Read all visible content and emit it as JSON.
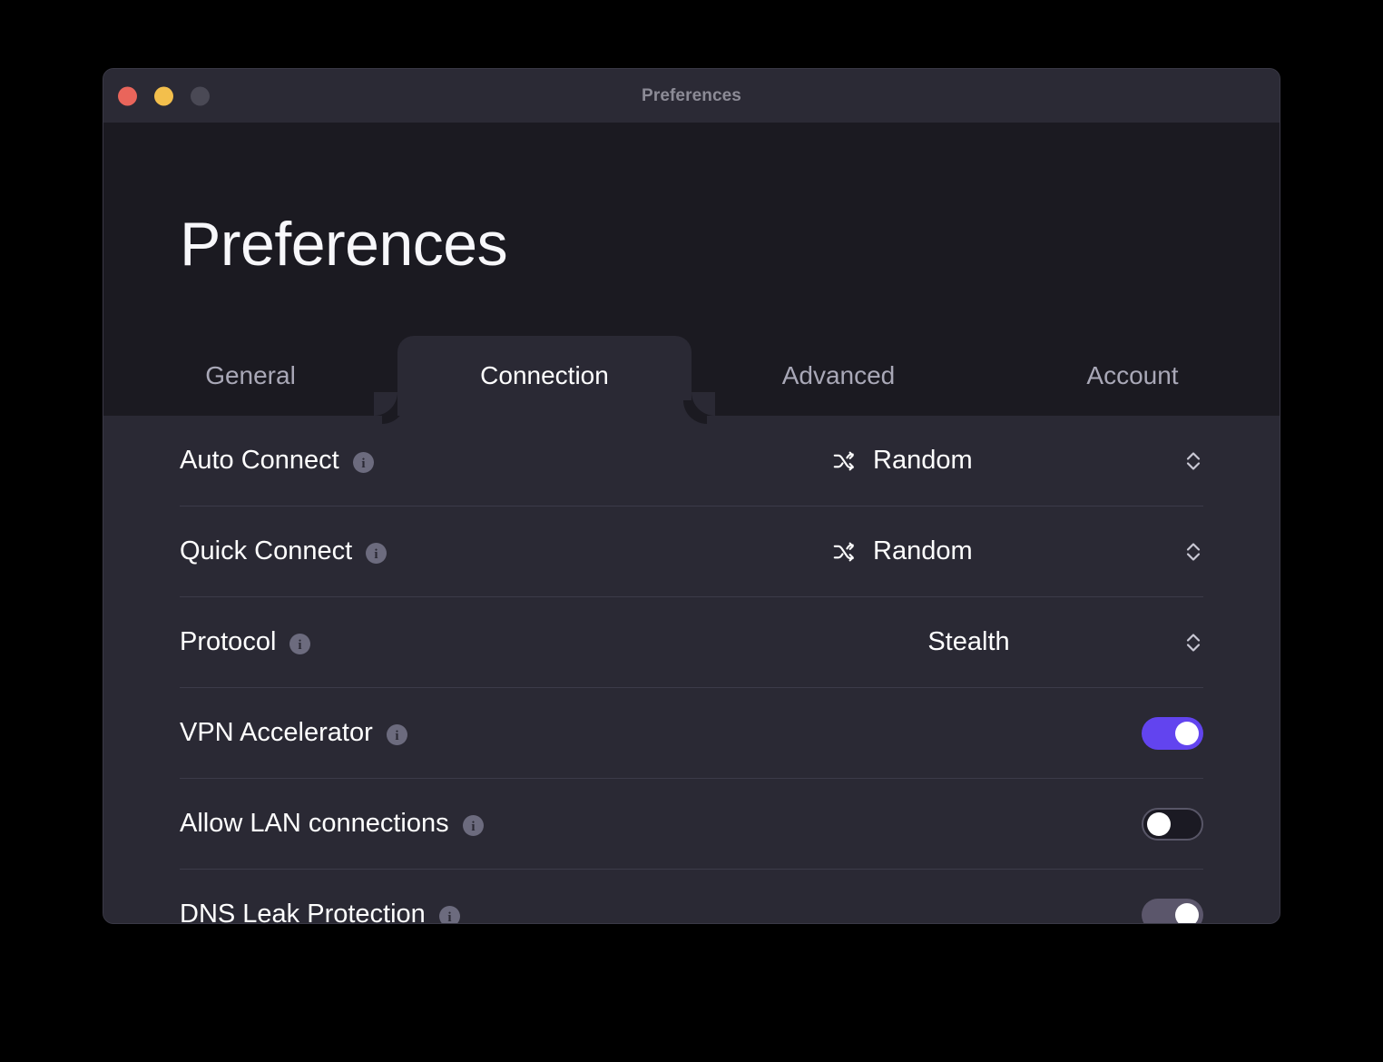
{
  "window": {
    "titlebar_title": "Preferences",
    "traffic_lights": [
      {
        "name": "close",
        "color": "#e9655b"
      },
      {
        "name": "minimize",
        "color": "#f3bf4c"
      },
      {
        "name": "zoom",
        "color": "#4a4955"
      }
    ]
  },
  "header": {
    "page_title": "Preferences"
  },
  "tabs": [
    {
      "label": "General",
      "active": false
    },
    {
      "label": "Connection",
      "active": true
    },
    {
      "label": "Advanced",
      "active": false
    },
    {
      "label": "Account",
      "active": false
    }
  ],
  "settings": [
    {
      "label": "Auto Connect",
      "info_icon": "info-icon",
      "control": "select",
      "value": "Random",
      "value_icon": "shuffle-icon",
      "stepper_icon": "chevron-up-down-icon"
    },
    {
      "label": "Quick Connect",
      "info_icon": "info-icon",
      "control": "select",
      "value": "Random",
      "value_icon": "shuffle-icon",
      "stepper_icon": "chevron-up-down-icon"
    },
    {
      "label": "Protocol",
      "info_icon": "info-icon",
      "control": "select",
      "value": "Stealth",
      "value_icon": null,
      "stepper_icon": "chevron-up-down-icon"
    },
    {
      "label": "VPN Accelerator",
      "info_icon": "info-icon",
      "control": "toggle",
      "state": "on",
      "toggle_color": "#6244ef"
    },
    {
      "label": "Allow LAN connections",
      "info_icon": "info-icon",
      "control": "toggle",
      "state": "off",
      "toggle_color": "#1b1a23"
    },
    {
      "label": "DNS Leak Protection",
      "info_icon": "info-icon",
      "control": "toggle",
      "state": "on-muted",
      "toggle_color": "#5b566b"
    }
  ],
  "colors": {
    "accent": "#6244ef",
    "header_bg": "#1b1a21",
    "body_bg": "#2a2934",
    "titlebar_bg": "#2b2a35",
    "separator": "#3c3b49",
    "muted_text": "#a9a8b7"
  }
}
